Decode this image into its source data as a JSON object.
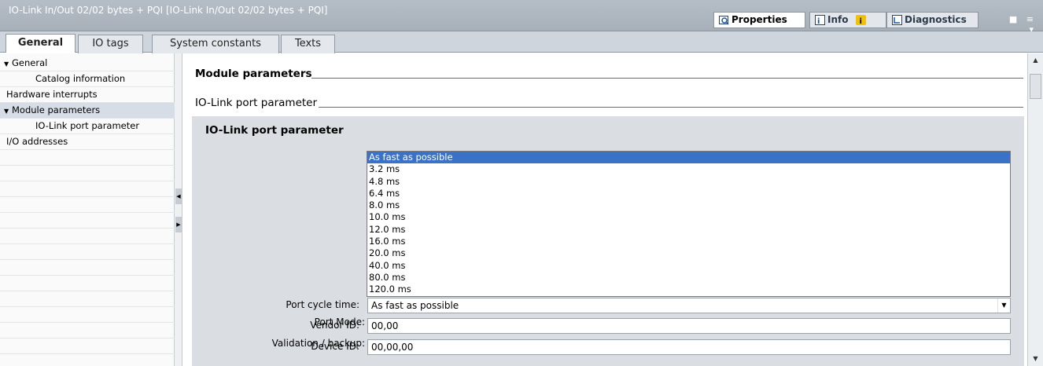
{
  "window": {
    "title": "IO-Link In/Out 02/02 bytes + PQI [IO-Link In/Out 02/02 bytes + PQI]",
    "controls": "■ ≡ ▾"
  },
  "inspector_tabs": [
    {
      "label": "Properties",
      "icon": "properties-icon",
      "active": true
    },
    {
      "label": "Info",
      "icon": "info-icon",
      "badge": "i"
    },
    {
      "label": "Diagnostics",
      "icon": "diagnostics-icon"
    }
  ],
  "tabs": [
    {
      "label": "General",
      "active": true
    },
    {
      "label": "IO tags"
    },
    {
      "label": "System constants"
    },
    {
      "label": "Texts"
    }
  ],
  "nav": {
    "items": [
      {
        "label": "General",
        "expanded": true,
        "indent": 0
      },
      {
        "label": "Catalog information",
        "indent": 1
      },
      {
        "label": "Hardware interrupts",
        "indent": 0
      },
      {
        "label": "Module parameters",
        "expanded": true,
        "indent": 0,
        "selected": true
      },
      {
        "label": "IO-Link port parameter",
        "indent": 1
      },
      {
        "label": "I/O addresses",
        "indent": 0
      }
    ]
  },
  "content": {
    "section_title": "Module parameters",
    "subsection_title": "IO-Link port parameter",
    "panel_title": "IO-Link port parameter",
    "fields": {
      "port_mode_label": "Port Mode:",
      "validation_label": "Validation / backup:",
      "cycle_time_label": "Port cycle time:",
      "cycle_time_value": "As fast as possible",
      "vendor_id_label": "Vendor ID:",
      "vendor_id_value": "00,00",
      "device_id_label": "Device ID:",
      "device_id_value": "00,00,00"
    },
    "dropdown_options": [
      "As fast as possible",
      "3.2 ms",
      "4.8 ms",
      "6.4 ms",
      "8.0 ms",
      "10.0 ms",
      "12.0 ms",
      "16.0 ms",
      "20.0 ms",
      "40.0 ms",
      "80.0 ms",
      "120.0 ms"
    ],
    "dropdown_selected": "As fast as possible"
  },
  "colors": {
    "selection": "#3a72c8",
    "panel": "#dadee2",
    "titlebar": "#aab3bc"
  }
}
